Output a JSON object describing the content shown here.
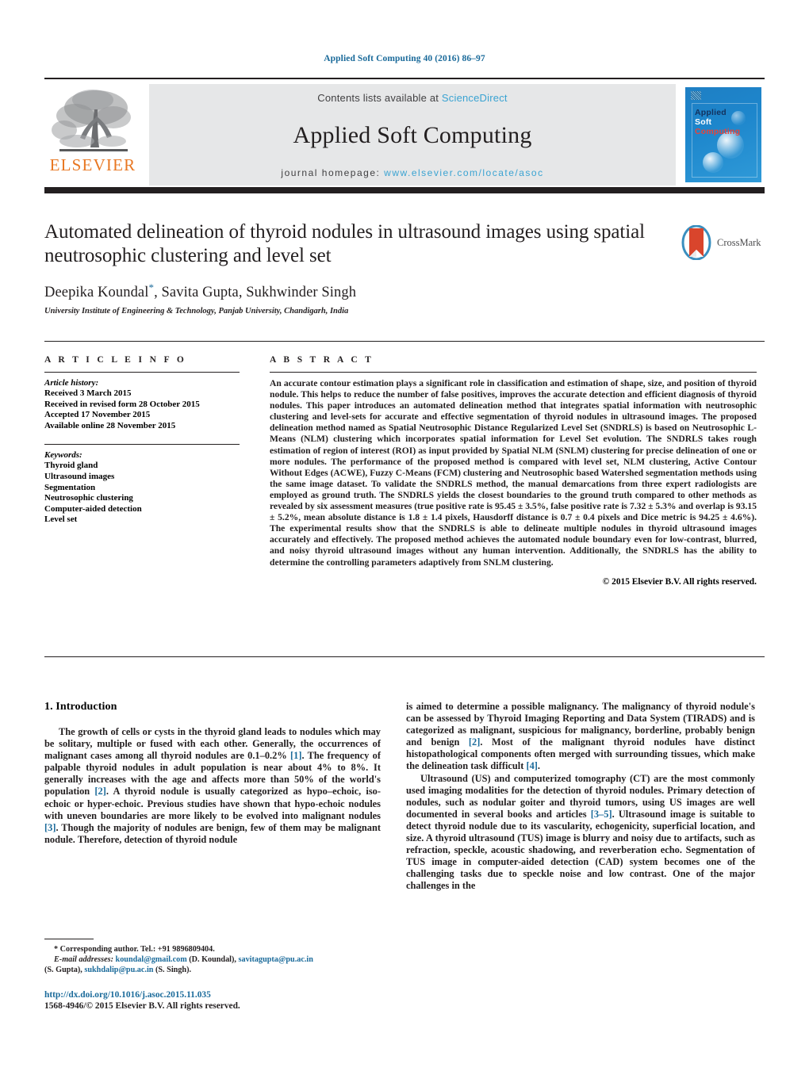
{
  "running_head": "Applied Soft Computing 40 (2016) 86–97",
  "masthead": {
    "publisher_logo_text": "ELSEVIER",
    "contents_prefix": "Contents lists available at ",
    "contents_link": "ScienceDirect",
    "journal_title": "Applied Soft Computing",
    "homepage_prefix": "journal homepage: ",
    "homepage_url": "www.elsevier.com/locate/asoc",
    "cover": {
      "line1": "Applied",
      "line2": "Soft",
      "line3": "Computing"
    }
  },
  "article": {
    "title": "Automated delineation of thyroid nodules in ultrasound images using spatial neutrosophic clustering and level set",
    "authors": "Deepika Koundal, Savita Gupta, Sukhwinder Singh",
    "corresponding_marker": "*",
    "affiliation": "University Institute of Engineering & Technology, Panjab University, Chandigarh, India",
    "crossmark_label": "CrossMark"
  },
  "article_info": {
    "section_label": "A R T I C L E    I N F O",
    "history_heading": "Article history:",
    "history": [
      "Received 3 March 2015",
      "Received in revised form 28 October 2015",
      "Accepted 17 November 2015",
      "Available online 28 November 2015"
    ],
    "keywords_heading": "Keywords:",
    "keywords": [
      "Thyroid gland",
      "Ultrasound images",
      "Segmentation",
      "Neutrosophic clustering",
      "Computer-aided detection",
      "Level set"
    ]
  },
  "abstract": {
    "section_label": "A B S T R A C T",
    "text": "An accurate contour estimation plays a significant role in classification and estimation of shape, size, and position of thyroid nodule. This helps to reduce the number of false positives, improves the accurate detection and efficient diagnosis of thyroid nodules. This paper introduces an automated delineation method that integrates spatial information with neutrosophic clustering and level-sets for accurate and effective segmentation of thyroid nodules in ultrasound images. The proposed delineation method named as Spatial Neutrosophic Distance Regularized Level Set (SNDRLS) is based on Neutrosophic L-Means (NLM) clustering which incorporates spatial information for Level Set evolution. The SNDRLS takes rough estimation of region of interest (ROI) as input provided by Spatial NLM (SNLM) clustering for precise delineation of one or more nodules. The performance of the proposed method is compared with level set, NLM clustering, Active Contour Without Edges (ACWE), Fuzzy C-Means (FCM) clustering and Neutrosophic based Watershed segmentation methods using the same image dataset. To validate the SNDRLS method, the manual demarcations from three expert radiologists are employed as ground truth. The SNDRLS yields the closest boundaries to the ground truth compared to other methods as revealed by six assessment measures (true positive rate is 95.45 ± 3.5%, false positive rate is 7.32 ± 5.3% and overlap is 93.15 ± 5.2%, mean absolute distance is 1.8 ± 1.4 pixels, Hausdorff distance is 0.7 ± 0.4 pixels and Dice metric is 94.25 ± 4.6%). The experimental results show that the SNDRLS is able to delineate multiple nodules in thyroid ultrasound images accurately and effectively. The proposed method achieves the automated nodule boundary even for low-contrast, blurred, and noisy thyroid ultrasound images without any human intervention. Additionally, the SNDRLS has the ability to determine the controlling parameters adaptively from SNLM clustering.",
    "copyright": "© 2015 Elsevier B.V. All rights reserved."
  },
  "body": {
    "section_number_title": "1.  Introduction",
    "left_paragraphs": [
      "The growth of cells or cysts in the thyroid gland leads to nodules which may be solitary, multiple or fused with each other. Generally, the occurrences of malignant cases among all thyroid nodules are 0.1–0.2% [1]. The frequency of palpable thyroid nodules in adult population is near about 4% to 8%. It generally increases with the age and affects more than 50% of the world's population [2]. A thyroid nodule is usually categorized as hypo–echoic, iso-echoic or hyper-echoic. Previous studies have shown that hypo-echoic nodules with uneven boundaries are more likely to be evolved into malignant nodules [3]. Though the majority of nodules are benign, few of them may be malignant nodule. Therefore, detection of thyroid nodule"
    ],
    "right_paragraphs": [
      "is aimed to determine a possible malignancy. The malignancy of thyroid nodule's can be assessed by Thyroid Imaging Reporting and Data System (TIRADS) and is categorized as malignant, suspicious for malignancy, borderline, probably benign and benign [2]. Most of the malignant thyroid nodules have distinct histopathological components often merged with surrounding tissues, which make the delineation task difficult [4].",
      "Ultrasound (US) and computerized tomography (CT) are the most commonly used imaging modalities for the detection of thyroid nodules. Primary detection of nodules, such as nodular goiter and thyroid tumors, using US images are well documented in several books and articles [3–5]. Ultrasound image is suitable to detect thyroid nodule due to its vascularity, echogenicity, superficial location, and size. A thyroid ultrasound (TUS) image is blurry and noisy due to artifacts, such as refraction, speckle, acoustic shadowing, and reverberation echo. Segmentation of TUS image in computer-aided detection (CAD) system becomes one of the challenging tasks due to speckle noise and low contrast. One of the major challenges in the"
    ]
  },
  "footnotes": {
    "corresponding": "* Corresponding author. Tel.: +91 9896809404.",
    "email_label": "E-mail addresses:",
    "emails": [
      {
        "address": "koundal@gmail.com",
        "owner": "(D. Koundal),"
      },
      {
        "address": "savitagupta@pu.ac.in",
        "owner": "(S. Gupta),"
      },
      {
        "address": "sukhdalip@pu.ac.in",
        "owner": "(S. Singh)."
      }
    ]
  },
  "doi": {
    "url": "http://dx.doi.org/10.1016/j.asoc.2015.11.035",
    "issn_line": "1568-4946/© 2015 Elsevier B.V. All rights reserved."
  },
  "colors": {
    "link": "#1a6a9a",
    "sciencedirect": "#3aa3d2",
    "elsevier_orange": "#e87722",
    "masthead_grey": "#e6e7e8",
    "ink": "#231f20"
  }
}
